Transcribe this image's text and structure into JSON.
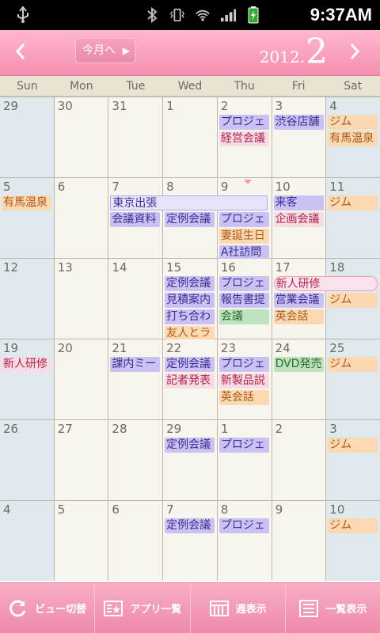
{
  "statusbar": {
    "time": "9:37AM"
  },
  "header": {
    "today_label": "今月へ",
    "year": "2012.",
    "month": "2"
  },
  "weekdays": [
    "Sun",
    "Mon",
    "Tue",
    "Wed",
    "Thu",
    "Fri",
    "Sat"
  ],
  "days": [
    "29",
    "30",
    "31",
    "1",
    "2",
    "3",
    "4",
    "5",
    "6",
    "7",
    "8",
    "9",
    "10",
    "11",
    "12",
    "13",
    "14",
    "15",
    "16",
    "17",
    "18",
    "19",
    "20",
    "21",
    "22",
    "23",
    "24",
    "25",
    "26",
    "27",
    "28",
    "29",
    "1",
    "2",
    "3",
    "4",
    "5",
    "6",
    "7",
    "8",
    "9",
    "10"
  ],
  "events": {
    "e1": "プロジェ",
    "e2": "経営会議",
    "e3": "渋谷店舗",
    "e4": "ジム",
    "e5": "有馬温泉",
    "e6": "有馬温泉",
    "e7": "東京出張",
    "e8": "会議資料",
    "e9": "定例会議",
    "e10": "プロジェ",
    "e11": "妻誕生日",
    "e12": "A社訪問",
    "e13": "来客",
    "e14": "企画会議",
    "e15": "ジム",
    "e16": "定例会議",
    "e17": "見積案内",
    "e18": "打ち合わ",
    "e19": "友人とラ",
    "e20": "プロジェ",
    "e21": "報告書提",
    "e22": "会議",
    "e23": "新人研修",
    "e24": "営業会議",
    "e25": "英会話",
    "e26": "ジム",
    "e27": "新人研修",
    "e28": "課内ミー",
    "e29": "定例会議",
    "e30": "記者発表",
    "e31": "プロジェ",
    "e32": "新製品説",
    "e33": "英会話",
    "e34": "DVD発売",
    "e35": "ジム",
    "e36": "定例会議",
    "e37": "プロジェ",
    "e38": "ジム",
    "e39": "定例会議",
    "e40": "プロジェ",
    "e41": "ジム"
  },
  "bottombar": {
    "view_toggle": "ビュー切替",
    "app_list": "アプリ一覧",
    "week_view": "週表示",
    "list_view": "一覧表示"
  }
}
